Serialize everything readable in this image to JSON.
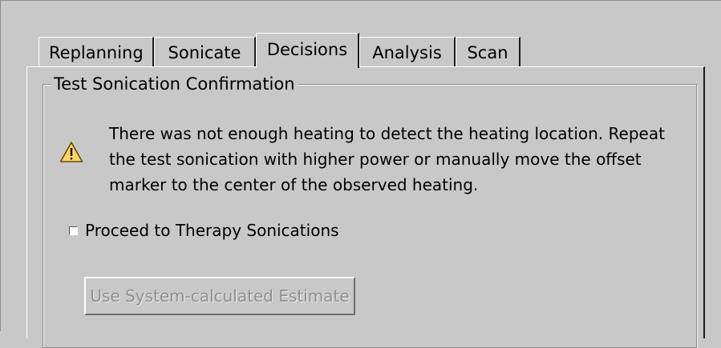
{
  "tabs": [
    {
      "label": "Replanning",
      "active": false
    },
    {
      "label": "Sonicate",
      "active": false
    },
    {
      "label": "Decisions",
      "active": true
    },
    {
      "label": "Analysis",
      "active": false
    },
    {
      "label": "Scan",
      "active": false
    }
  ],
  "group": {
    "title": "Test Sonication Confirmation",
    "warning_icon": "warning-triangle-icon",
    "message": "There was not enough heating to detect the heating location. Repeat\nthe test sonication with higher power or manually move the offset\nmarker to the center of the observed heating.",
    "checkbox": {
      "label": "Proceed to Therapy Sonications",
      "checked": false
    },
    "estimate_button": {
      "label": "Use System-calculated Estimate",
      "enabled": false
    }
  },
  "colors": {
    "background": "#c8c8c8",
    "warning_fill": "#ffd36b",
    "disabled_text": "#8f8f8f"
  }
}
